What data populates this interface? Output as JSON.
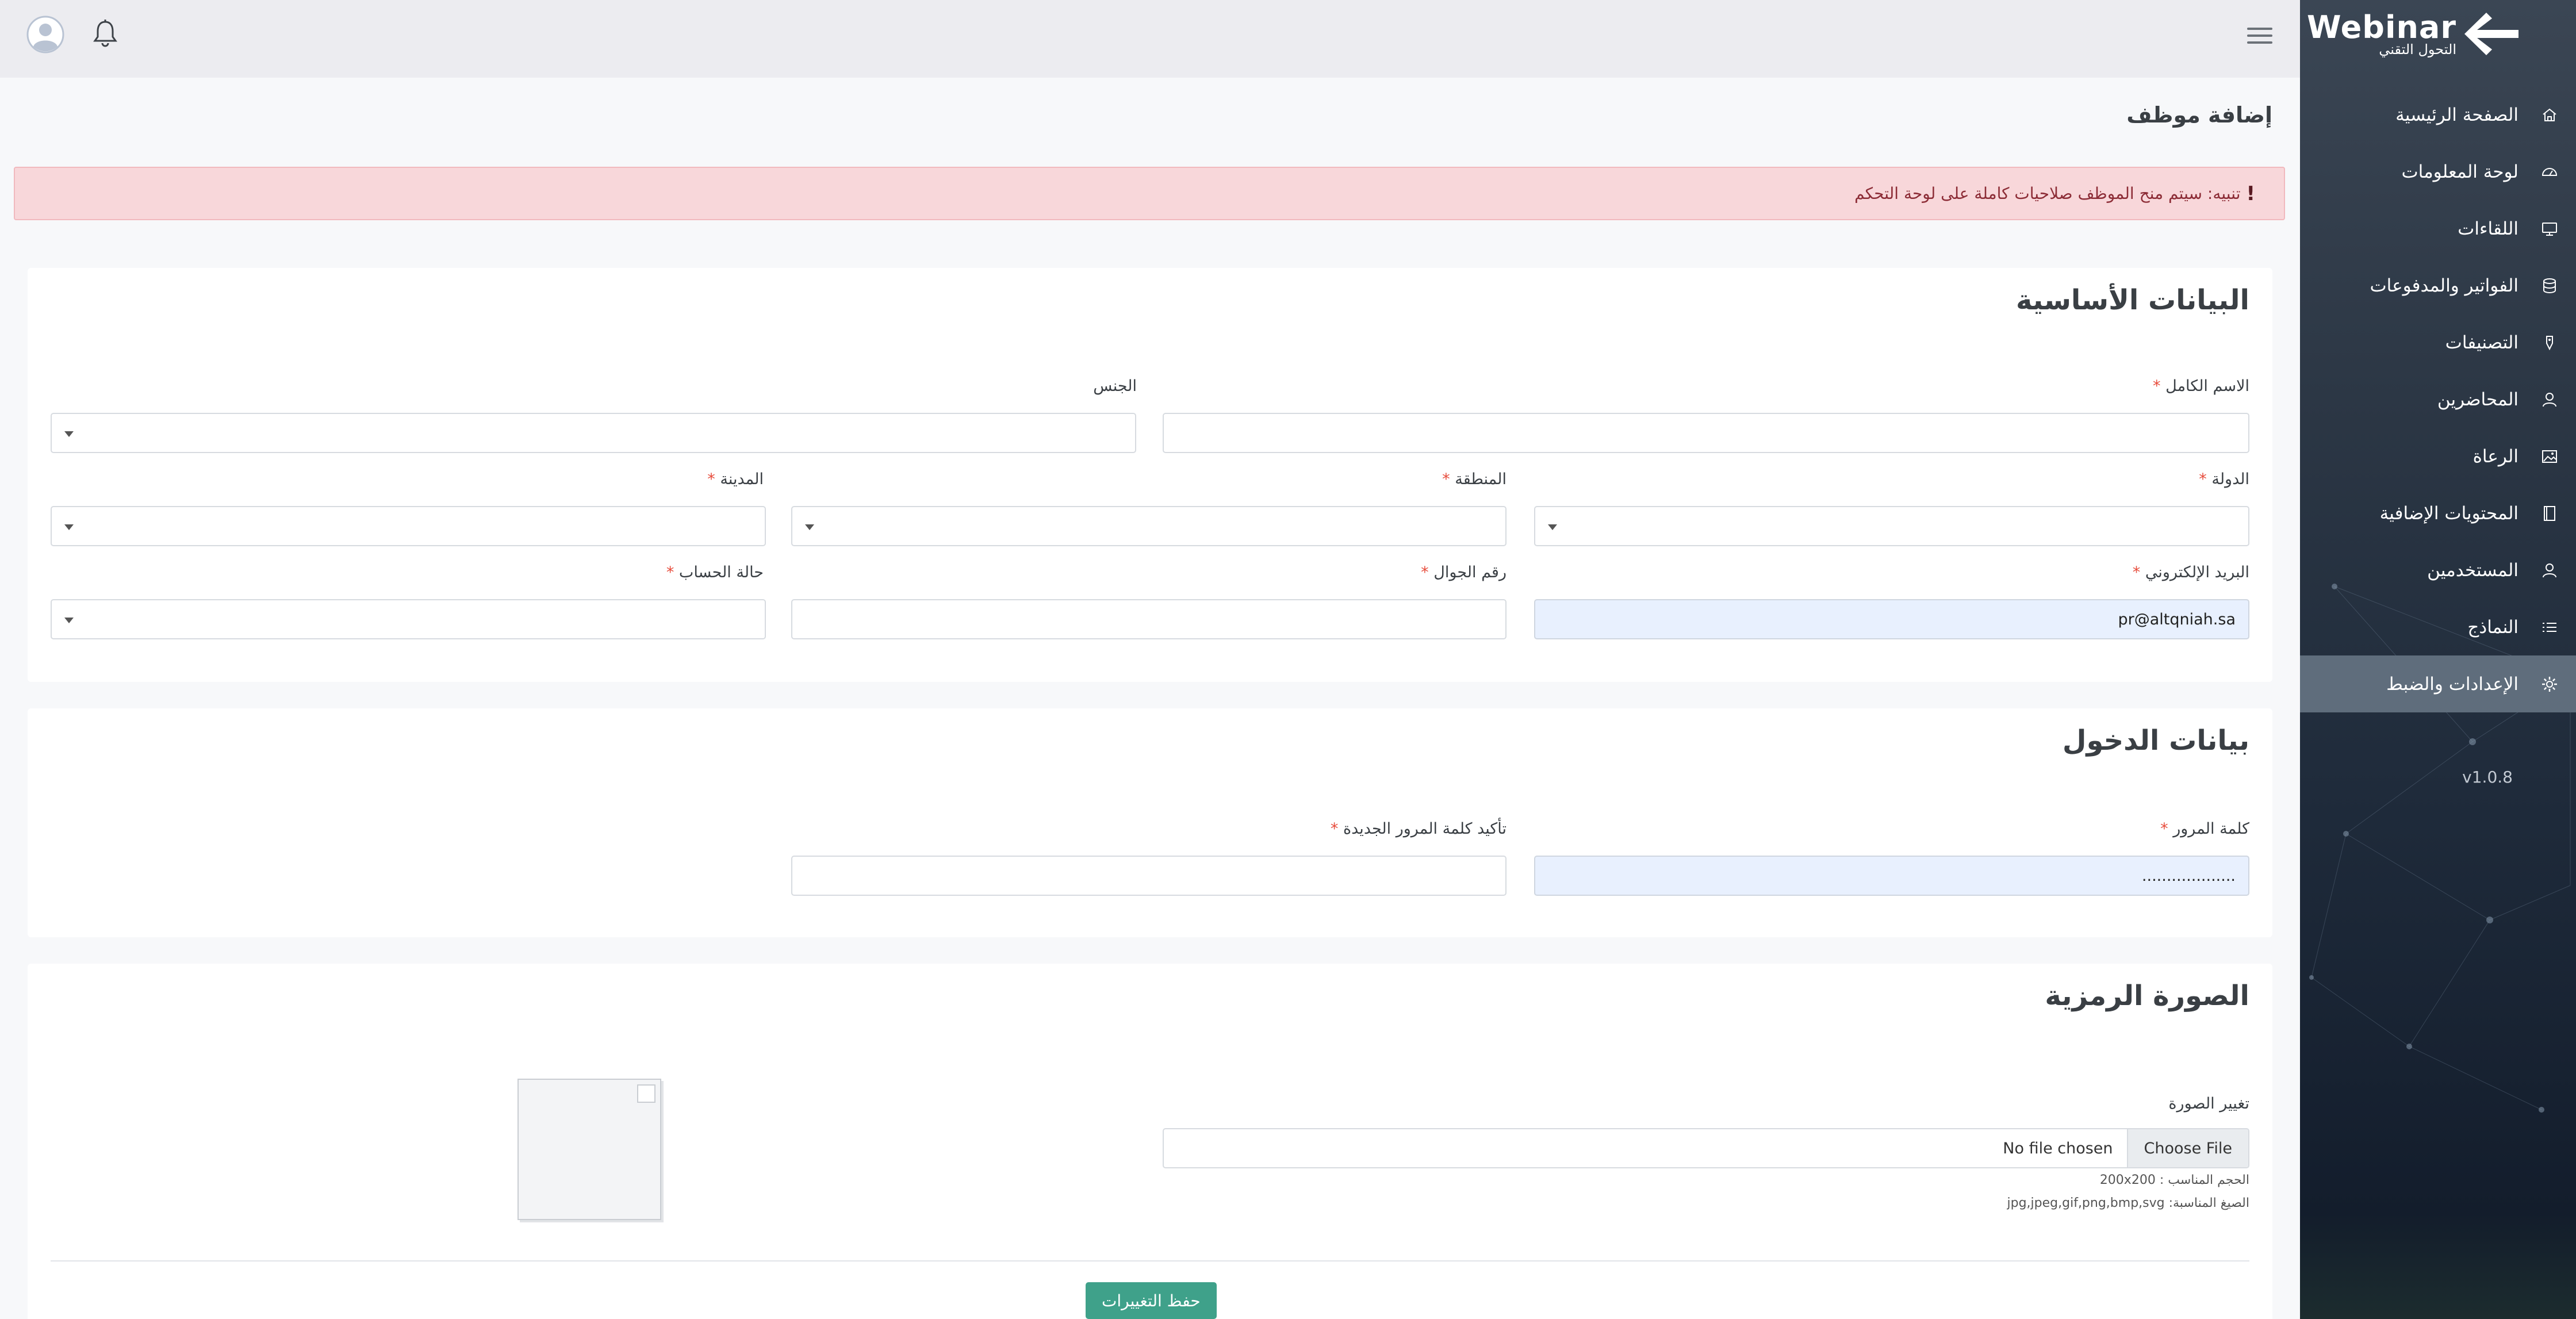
{
  "brand": {
    "name": "Webinar",
    "tagline": "التحول التقني"
  },
  "sidebar": {
    "items": [
      {
        "label": "الصفحة الرئيسية",
        "icon": "home-icon",
        "active": false
      },
      {
        "label": "لوحة المعلومات",
        "icon": "dashboard-icon",
        "active": false
      },
      {
        "label": "اللقاءات",
        "icon": "monitor-icon",
        "active": false
      },
      {
        "label": "الفواتير والمدفوعات",
        "icon": "database-icon",
        "active": false
      },
      {
        "label": "التصنيفات",
        "icon": "tag-icon",
        "active": false
      },
      {
        "label": "المحاضرين",
        "icon": "user-icon",
        "active": false
      },
      {
        "label": "الرعاة",
        "icon": "image-icon",
        "active": false
      },
      {
        "label": "المحتويات الإضافية",
        "icon": "book-icon",
        "active": false
      },
      {
        "label": "المستخدمين",
        "icon": "users-icon",
        "active": false
      },
      {
        "label": "النماذج",
        "icon": "list-icon",
        "active": false
      },
      {
        "label": "الإعدادات والضبط",
        "icon": "gear-icon",
        "active": true
      }
    ],
    "version": "v1.0.8"
  },
  "page": {
    "title": "إضافة موظف"
  },
  "alert": {
    "mark": "!",
    "text": "تنبيه: سيتم منح الموظف صلاحيات كاملة على لوحة التحكم"
  },
  "basic": {
    "title": "البيانات الأساسية",
    "full_name": {
      "label": "الاسم الكامل",
      "value": ""
    },
    "gender": {
      "label": "الجنس",
      "value": ""
    },
    "country": {
      "label": "الدولة",
      "value": ""
    },
    "region": {
      "label": "المنطقة",
      "value": ""
    },
    "city": {
      "label": "المدينة",
      "value": ""
    },
    "email": {
      "label": "البريد الإلكتروني",
      "value": "pr@altqniah.sa"
    },
    "mobile": {
      "label": "رقم الجوال",
      "value": ""
    },
    "status": {
      "label": "حالة الحساب",
      "value": ""
    },
    "required_mark": "*"
  },
  "login": {
    "title": "بيانات الدخول",
    "password": {
      "label": "كلمة المرور",
      "value": "..................."
    },
    "confirm": {
      "label": "تأكيد كلمة المرور الجديدة",
      "value": ""
    }
  },
  "avatar_section": {
    "title": "الصورة الرمزية",
    "change_label": "تغيير الصورة",
    "choose_button": "Choose File",
    "file_name": "No file chosen",
    "size_hint": "الحجم المناسب : 200x200",
    "format_hint": "الصيغ المناسبة: jpg,jpeg,gif,png,bmp,svg"
  },
  "actions": {
    "save": "حفظ التغييرات"
  },
  "colors": {
    "accent": "#3fa18a",
    "alert_bg": "#f8d7da",
    "sidebar_active": "#5f6d7c",
    "required": "#e74c3c"
  }
}
